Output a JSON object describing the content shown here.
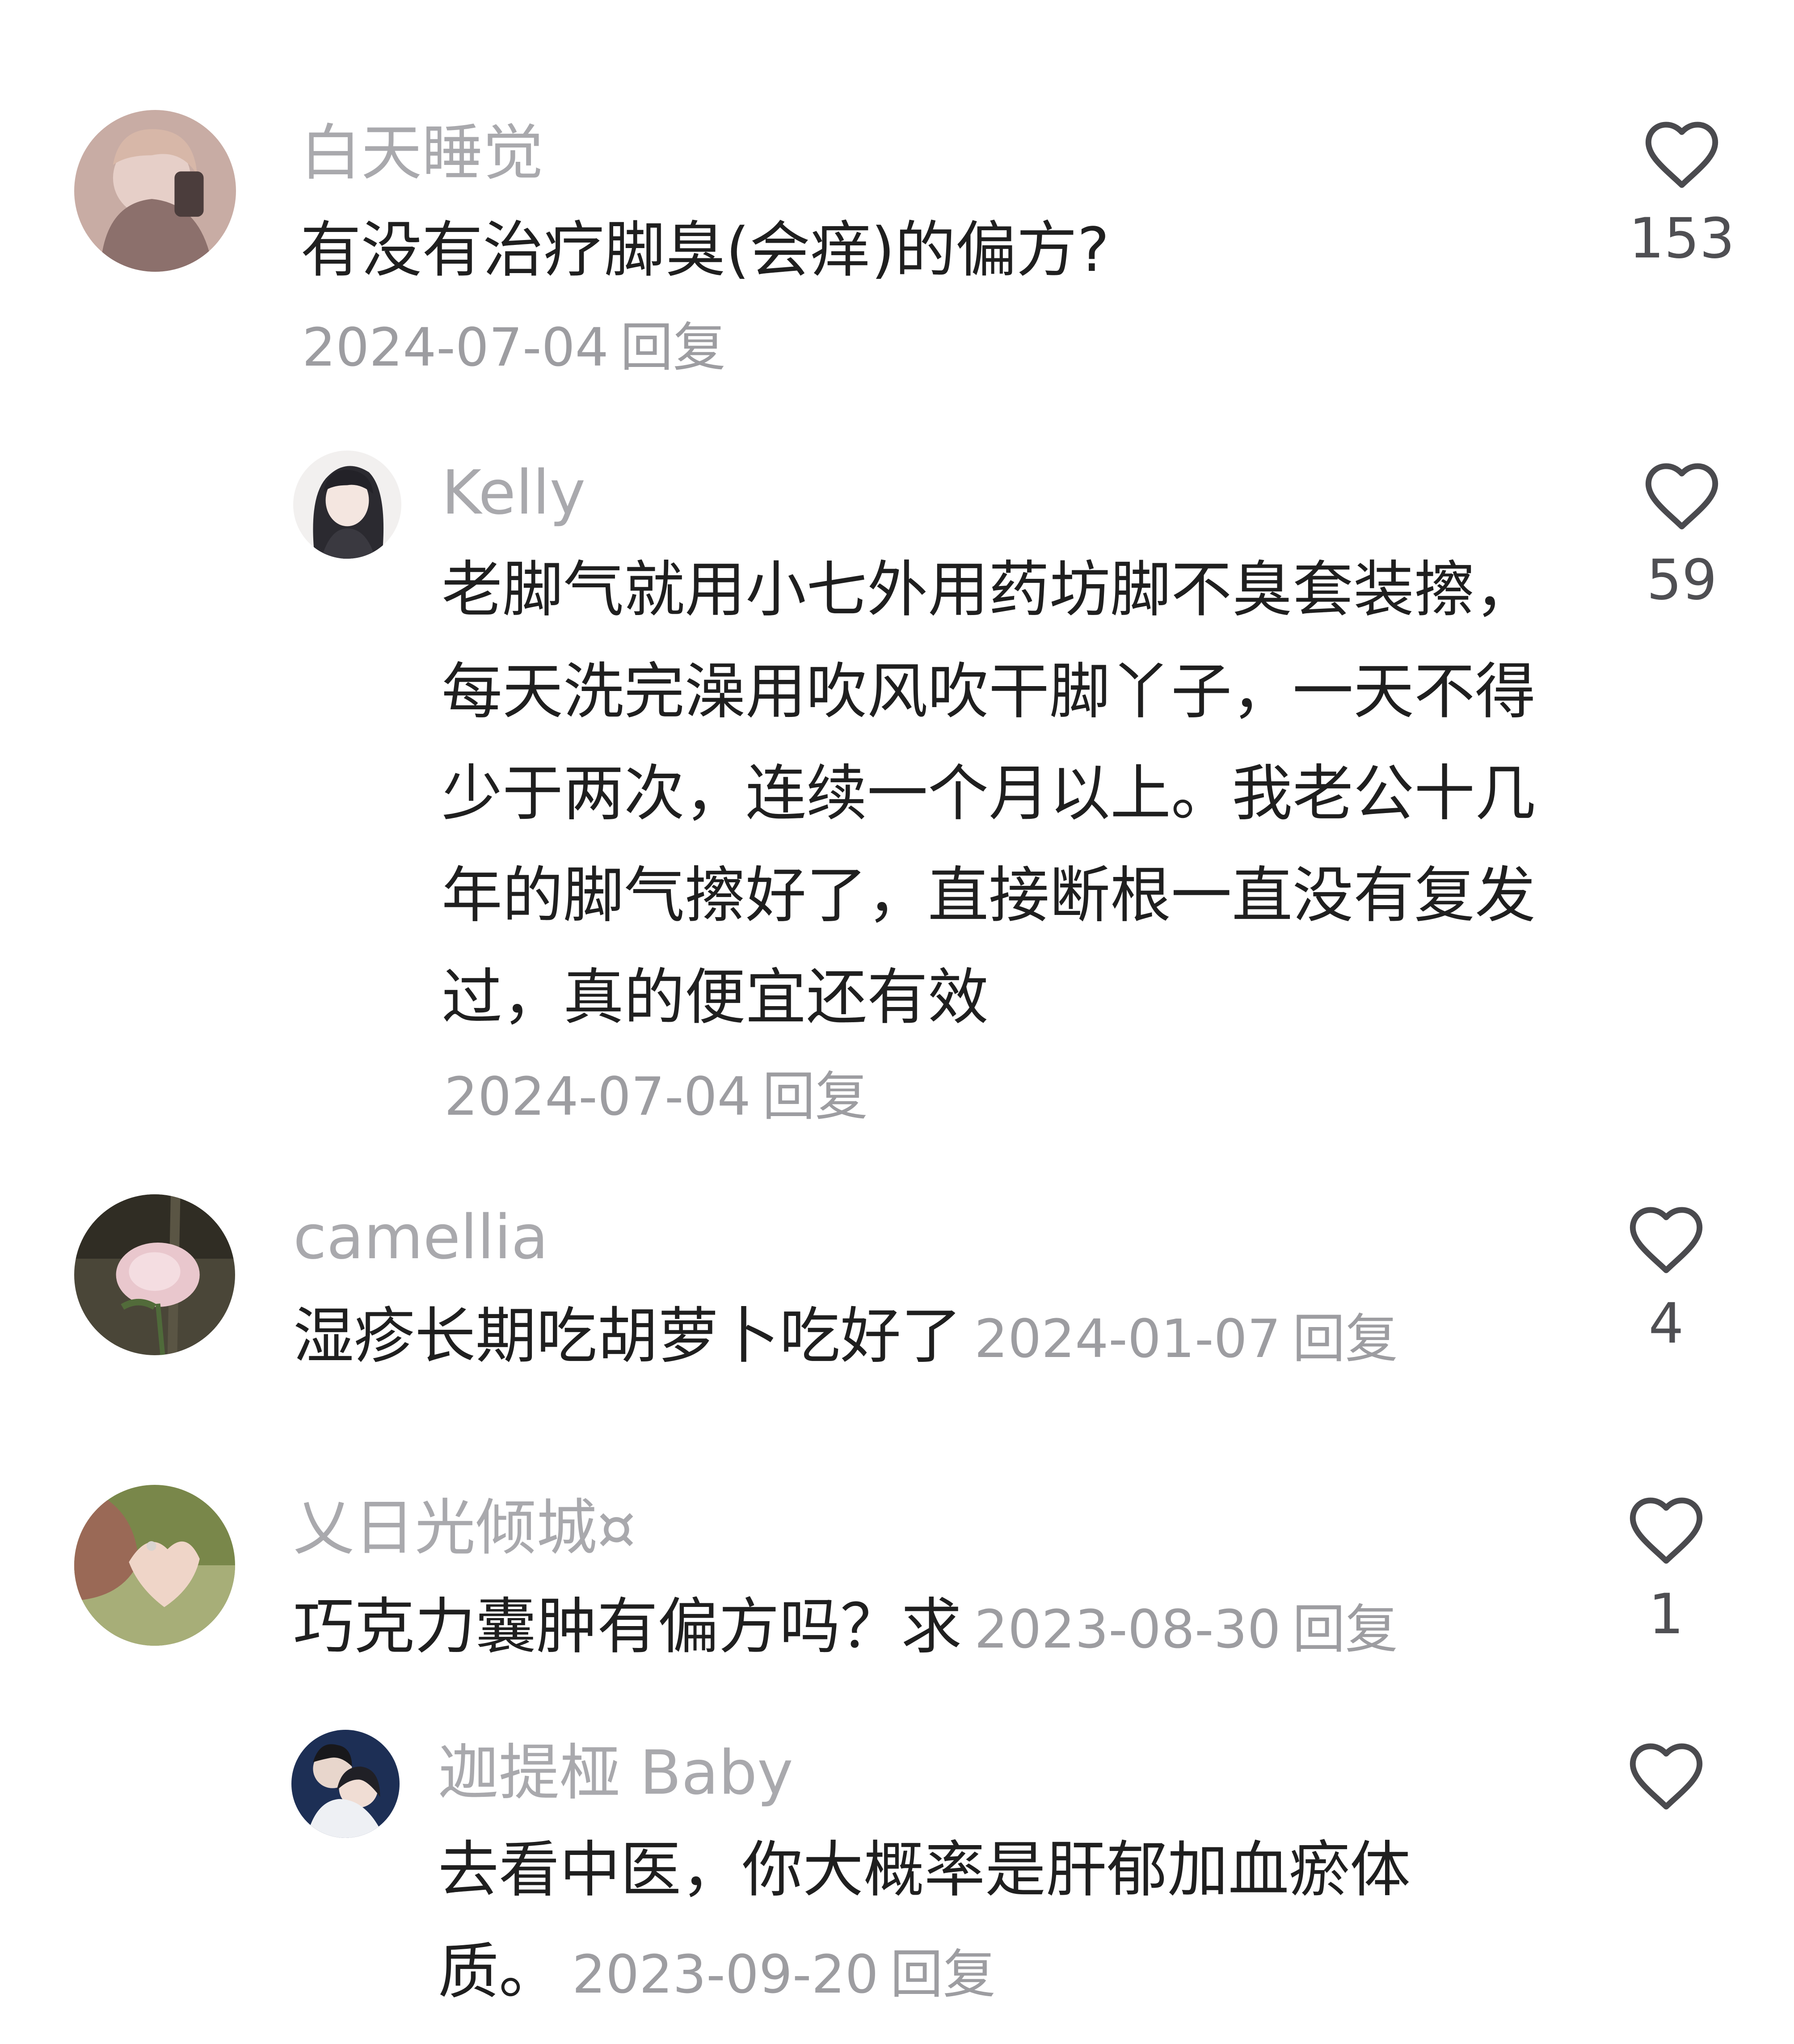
{
  "comments": [
    {
      "username": "白天睡觉",
      "text": "有没有治疗脚臭(会痒)的偏方?",
      "date": "2024-07-04",
      "reply": "回复",
      "likes": "153"
    },
    {
      "username": "Kelly",
      "text": "老脚气就用小七外用药坊脚不臭套装擦，每天洗完澡用吹风吹干脚丫子，一天不得少于两次，连续一个月以上。我老公十几年的脚气擦好了，直接断根一直没有复发过，真的便宜还有效",
      "date": "2024-07-04",
      "reply": "回复",
      "likes": "59"
    },
    {
      "username": "camellia",
      "text": "湿疹长期吃胡萝卜吃好了",
      "date": "2024-01-07",
      "reply": "回复",
      "likes": "4"
    },
    {
      "username": "乂日光倾城¤",
      "text": "巧克力囊肿有偏方吗？求",
      "date": "2023-08-30",
      "reply": "回复",
      "likes": "1"
    },
    {
      "username": "迦提桠 Baby",
      "text": "去看中医，你大概率是肝郁加血瘀体质。",
      "date": "2023-09-20",
      "reply": "回复",
      "likes": ""
    }
  ],
  "colors": {
    "username": "#a9a9ad",
    "text": "#1f1f1f",
    "meta": "#9d9da1",
    "like_icon": "#4a4a4e"
  },
  "icons": {
    "like": "heart-outline-icon"
  }
}
